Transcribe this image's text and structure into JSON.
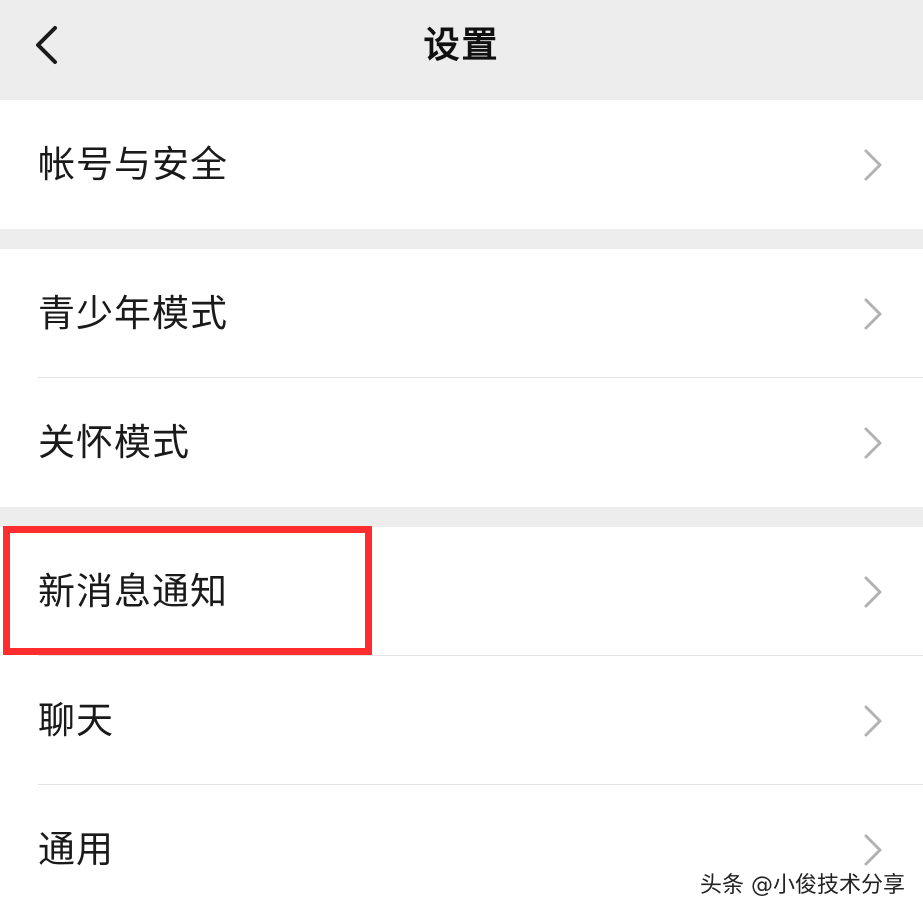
{
  "nav": {
    "title": "设置",
    "back_icon": "chevron-left-icon"
  },
  "groups": [
    {
      "items": [
        {
          "label": "帐号与安全"
        }
      ]
    },
    {
      "items": [
        {
          "label": "青少年模式"
        },
        {
          "label": "关怀模式"
        }
      ]
    },
    {
      "items": [
        {
          "label": "新消息通知"
        },
        {
          "label": "聊天"
        },
        {
          "label": "通用"
        }
      ]
    }
  ],
  "highlight": {
    "item": "新消息通知",
    "color": "#ff2d2d"
  },
  "watermark": "头条 @小俊技术分享",
  "colors": {
    "background": "#ededed",
    "row": "#ffffff",
    "chevron": "#b2b2b2"
  }
}
